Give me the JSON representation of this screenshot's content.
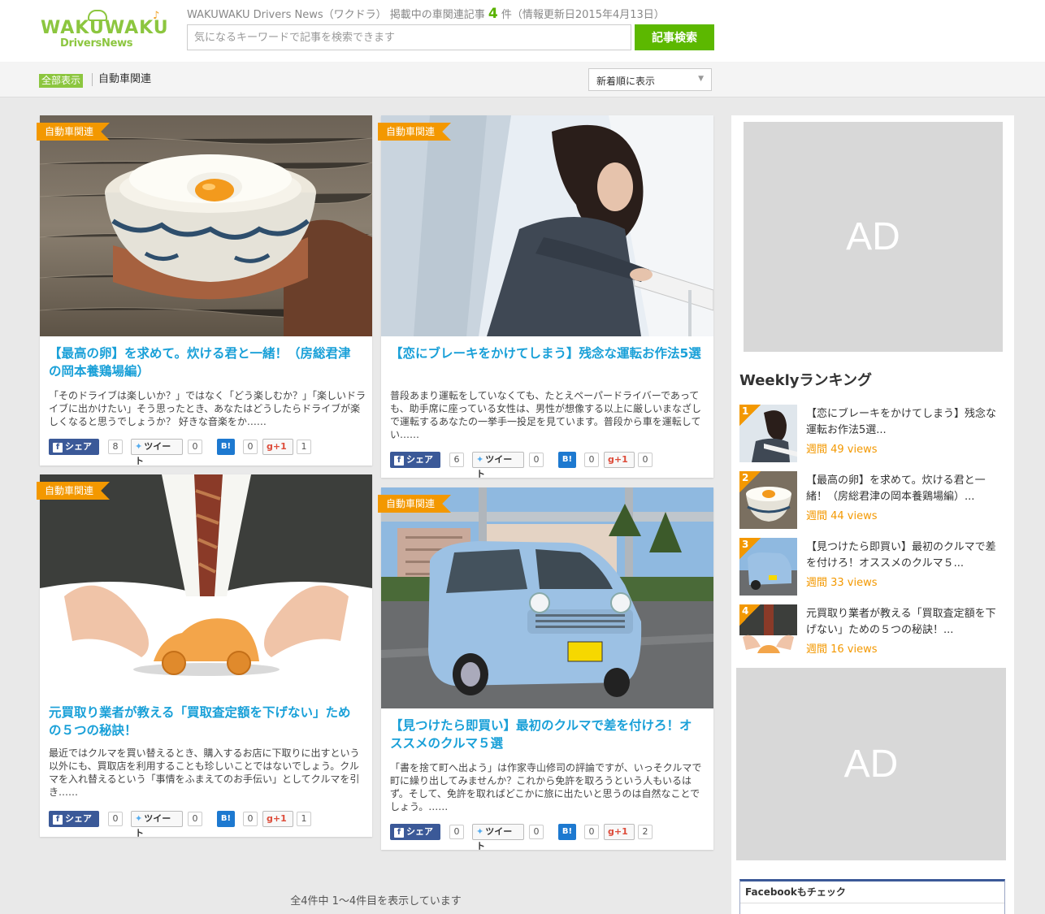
{
  "header": {
    "logo_top": "WAKUWAKU",
    "logo_bottom": "DriversNews",
    "tagline_prefix": "WAKUWAKU Drivers News（ワクドラ） 掲載中の車関連記事",
    "article_count": "4",
    "tagline_suffix": "件（情報更新日2015年4月13日）",
    "search_placeholder": "気になるキーワードで記事を検索できます",
    "search_button": "記事検索"
  },
  "filters": {
    "all_label": "全部表示",
    "category_label": "自動車関連",
    "sort_selected": "新着順に表示"
  },
  "articles": [
    {
      "tag": "自動車関連",
      "title": "【最高の卵】を求めて。炊ける君と一緒！（房総君津の岡本養鶏場編）",
      "excerpt": "「そのドライブは楽しいか？」ではなく「どう楽しむか？」「楽しいドライブに出かけたい」そう思ったとき、あなたはどうしたらドライブが楽しくなると思うでしょうか？ 好きな音楽をか……",
      "share_label": "シェア",
      "share_count": "8",
      "tweet_label": "ツイート",
      "tweet_count": "0",
      "hatena_label": "B!",
      "hatena_count": "0",
      "gplus_label": "g+1",
      "gplus_count": "1"
    },
    {
      "tag": "自動車関連",
      "title": "【恋にブレーキをかけてしまう】残念な運転お作法5選",
      "excerpt": "普段あまり運転をしていなくても、たとえペーパードライバーであっても、助手席に座っている女性は、男性が想像する以上に厳しいまなざしで運転するあなたの一挙手一投足を見ています。普段から車を運転してい……",
      "share_label": "シェア",
      "share_count": "6",
      "tweet_label": "ツイート",
      "tweet_count": "0",
      "hatena_label": "B!",
      "hatena_count": "0",
      "gplus_label": "g+1",
      "gplus_count": "0"
    },
    {
      "tag": "自動車関連",
      "title": "元買取り業者が教える「買取査定額を下げない」ための５つの秘訣！",
      "excerpt": "最近ではクルマを買い替えるとき、購入するお店に下取りに出すという以外にも、買取店を利用することも珍しいことではないでしょう。クルマを入れ替えるという「事情をふまえてのお手伝い」としてクルマを引き……",
      "share_label": "シェア",
      "share_count": "0",
      "tweet_label": "ツイート",
      "tweet_count": "0",
      "hatena_label": "B!",
      "hatena_count": "0",
      "gplus_label": "g+1",
      "gplus_count": "1"
    },
    {
      "tag": "自動車関連",
      "title": "【見つけたら即買い】最初のクルマで差を付けろ！オススメのクルマ５選",
      "excerpt": "「書を捨て町へ出よう」は作家寺山修司の評論ですが、いっそクルマで町に繰り出してみませんか？これから免許を取ろうという人もいるはず。そして、免許を取ればどこかに旅に出たいと思うのは自然なことでしょう。……",
      "share_label": "シェア",
      "share_count": "0",
      "tweet_label": "ツイート",
      "tweet_count": "0",
      "hatena_label": "B!",
      "hatena_count": "0",
      "gplus_label": "g+1",
      "gplus_count": "2"
    }
  ],
  "sidebar": {
    "ad_label_top": "AD",
    "ranking_title": "Weeklyランキング",
    "ranking": [
      {
        "rank": "1",
        "title": "【恋にブレーキをかけてしまう】残念な運転お作法5選...",
        "views": "週間 49 views"
      },
      {
        "rank": "2",
        "title": "【最高の卵】を求めて。炊ける君と一緒！（房総君津の岡本養鶏場編）...",
        "views": "週間 44 views"
      },
      {
        "rank": "3",
        "title": "【見つけたら即買い】最初のクルマで差を付けろ！オススメのクルマ５...",
        "views": "週間 33 views"
      },
      {
        "rank": "4",
        "title": "元買取り業者が教える「買取査定額を下げない」ための５つの秘訣！...",
        "views": "週間 16 views"
      }
    ],
    "ad_label_bottom": "AD",
    "facebook_title": "Facebookもチェック"
  },
  "pager": {
    "summary": "全4件中 1～4件目を表示しています"
  },
  "colors": {
    "accent_green": "#5cb800",
    "tag_orange": "#f39800",
    "title_blue": "#19a0d8"
  }
}
